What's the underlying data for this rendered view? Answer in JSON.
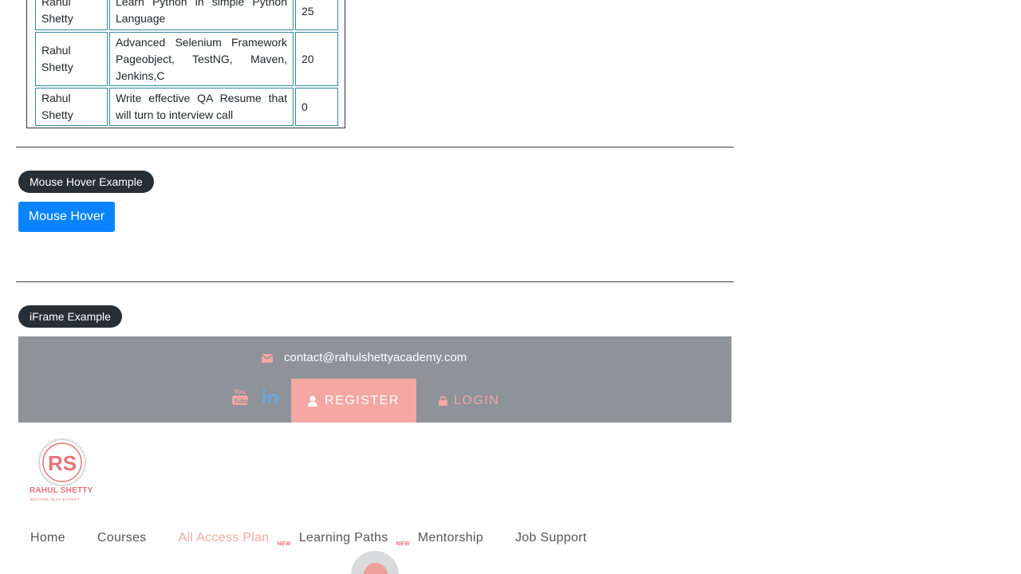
{
  "table": {
    "rows": [
      {
        "instructor": "Rahul Shetty",
        "course": "Learn Python in simple Python Language",
        "price": "25"
      },
      {
        "instructor": "Rahul Shetty",
        "course": "Advanced Selenium Framework Pageobject, TestNG, Maven, Jenkins,C",
        "price": "20"
      },
      {
        "instructor": "Rahul Shetty",
        "course": "Write effective QA Resume that will turn to interview call",
        "price": "0"
      }
    ]
  },
  "mouse_hover": {
    "legend": "Mouse Hover Example",
    "button_label": "Mouse Hover"
  },
  "iframe": {
    "legend": "iFrame Example",
    "contact_email": "contact@rahulshettyacademy.com",
    "register_label": "REGISTER",
    "login_label": "LOGIN",
    "social_icons": [
      "youtube-icon",
      "linkedin-icon"
    ]
  },
  "logo": {
    "monogram": "RS",
    "name": "RAHUL SHETTY",
    "tagline": "BECOME TEST EXPERT"
  },
  "nav": {
    "home": "Home",
    "courses": "Courses",
    "all_access": "All Access Plan",
    "badge1": "NEW",
    "learning_paths": "Learning Paths",
    "badge2": "NEW",
    "mentorship": "Mentorship",
    "job_support": "Job Support"
  },
  "colors": {
    "accent": "#f4a7a3",
    "button_blue": "#0a84ff",
    "pill_dark": "#262f33",
    "iframe_header": "#8e9299"
  }
}
